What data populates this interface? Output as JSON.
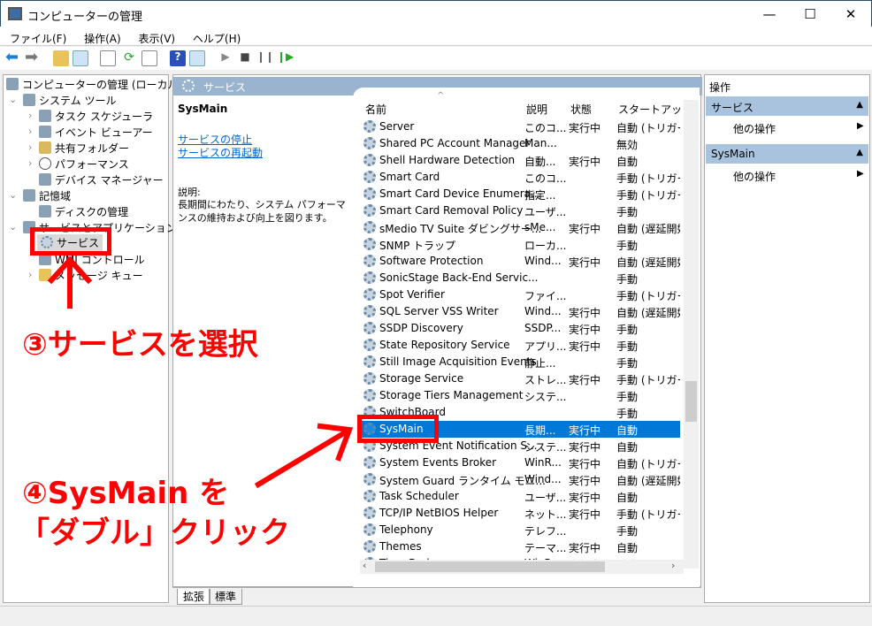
{
  "window": {
    "title": "コンピューターの管理",
    "minimize": "—",
    "maximize": "☐",
    "close": "✕"
  },
  "menu": [
    "ファイル(F)",
    "操作(A)",
    "表示(V)",
    "ヘルプ(H)"
  ],
  "tree": {
    "root": "コンピューターの管理 (ローカル)",
    "items": [
      {
        "label": "システム ツール",
        "level": 1,
        "chev": "⌄"
      },
      {
        "label": "タスク スケジューラ",
        "level": 2,
        "chev": "›"
      },
      {
        "label": "イベント ビューアー",
        "level": 2,
        "chev": "›"
      },
      {
        "label": "共有フォルダー",
        "level": 2,
        "chev": "›"
      },
      {
        "label": "パフォーマンス",
        "level": 2,
        "chev": "›"
      },
      {
        "label": "デバイス マネージャー",
        "level": 2,
        "chev": ""
      },
      {
        "label": "記憶域",
        "level": 1,
        "chev": "⌄"
      },
      {
        "label": "ディスクの管理",
        "level": 2,
        "chev": ""
      },
      {
        "label": "サービスとアプリケーション",
        "level": 1,
        "chev": "⌄"
      },
      {
        "label": "サービス",
        "level": 2,
        "chev": ""
      },
      {
        "label": "WMI コントロール",
        "level": 2,
        "chev": ""
      },
      {
        "label": "メッセージ キュー",
        "level": 2,
        "chev": "›"
      }
    ]
  },
  "middle": {
    "header": "サービス",
    "selected_name": "SysMain",
    "links": [
      "サービスの停止",
      "サービスの再起動"
    ],
    "desc_label": "説明:",
    "desc_text": "長期間にわたり、システム パフォーマンスの維持および向上を図ります。",
    "columns": [
      "名前",
      "説明",
      "状態",
      "スタートアップの種"
    ],
    "rows": [
      [
        "Server",
        "このコ...",
        "実行中",
        "自動 (トリガー開"
      ],
      [
        "Shared PC Account Manager",
        "Man...",
        "",
        "無効"
      ],
      [
        "Shell Hardware Detection",
        "自動...",
        "実行中",
        "自動"
      ],
      [
        "Smart Card",
        "このコ...",
        "",
        "手動 (トリガー開"
      ],
      [
        "Smart Card Device Enumera...",
        "指定...",
        "",
        "手動 (トリガー開"
      ],
      [
        "Smart Card Removal Policy",
        "ユーザ...",
        "",
        "手動"
      ],
      [
        "sMedio TV Suite ダビングサー...",
        "sMe...",
        "実行中",
        "自動 (遅延開始"
      ],
      [
        "SNMP トラップ",
        "ローカ...",
        "",
        "手動"
      ],
      [
        "Software Protection",
        "Wind...",
        "実行中",
        "自動 (遅延開始"
      ],
      [
        "SonicStage Back-End Servic...",
        "",
        "",
        "手動"
      ],
      [
        "Spot Verifier",
        "ファイ...",
        "",
        "手動 (トリガー開"
      ],
      [
        "SQL Server VSS Writer",
        "Wind...",
        "実行中",
        "自動 (遅延開始"
      ],
      [
        "SSDP Discovery",
        "SSDP...",
        "実行中",
        "手動"
      ],
      [
        "State Repository Service",
        "アプリ...",
        "実行中",
        "手動"
      ],
      [
        "Still Image Acquisition Events",
        "静止...",
        "",
        "手動"
      ],
      [
        "Storage Service",
        "ストレ...",
        "実行中",
        "手動 (トリガー開"
      ],
      [
        "Storage Tiers Management",
        "システ...",
        "",
        "手動"
      ],
      [
        "SwitchBoard",
        "",
        "",
        "手動"
      ],
      [
        "SysMain",
        "長期...",
        "実行中",
        "自動"
      ],
      [
        "System Event Notification S...",
        "システ...",
        "実行中",
        "自動"
      ],
      [
        "System Events Broker",
        "WinR...",
        "実行中",
        "自動 (トリガー開"
      ],
      [
        "System Guard ランタイム モニ...",
        "Wind...",
        "実行中",
        "自動 (遅延開始"
      ],
      [
        "Task Scheduler",
        "ユーザ...",
        "実行中",
        "自動"
      ],
      [
        "TCP/IP NetBIOS Helper",
        "ネット...",
        "実行中",
        "手動 (トリガー開"
      ],
      [
        "Telephony",
        "テレフ...",
        "",
        "手動"
      ],
      [
        "Themes",
        "テーマ...",
        "実行中",
        "自動"
      ],
      [
        "Time Broker",
        "WinR...",
        "実行中",
        "手動 (トリガー開"
      ]
    ],
    "selected_index": 18,
    "tabs": [
      "拡張",
      "標準"
    ]
  },
  "actions": {
    "title": "操作",
    "groups": [
      {
        "label": "サービス",
        "item": "他の操作"
      },
      {
        "label": "SysMain",
        "item": "他の操作"
      }
    ]
  },
  "annotations": {
    "step3": "③サービスを選択",
    "step4_line1": "④SysMain を",
    "step4_line2": "「ダブル」クリック",
    "color": "#ff0000"
  }
}
